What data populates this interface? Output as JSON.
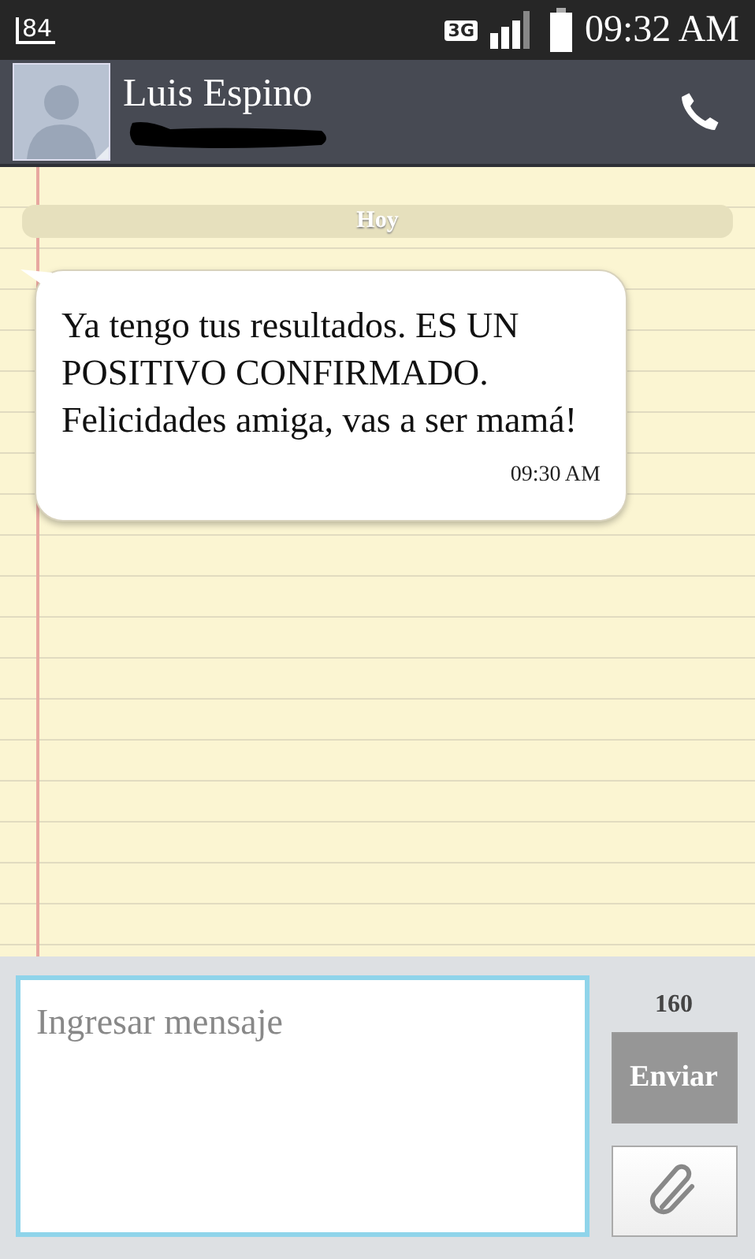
{
  "status_bar": {
    "notification_badge": "84",
    "network": "3G",
    "time": "09:32 AM"
  },
  "contact": {
    "name": "Luis Espino"
  },
  "date_divider": "Hoy",
  "messages": [
    {
      "text": "Ya tengo tus resultados. ES UN POSITIVO CONFIRMADO. Felicidades amiga, vas a ser mamá!",
      "time": "09:30 AM"
    }
  ],
  "composer": {
    "placeholder": "Ingresar mensaje",
    "char_count": "160",
    "send_label": "Enviar",
    "send_disabled": true
  }
}
